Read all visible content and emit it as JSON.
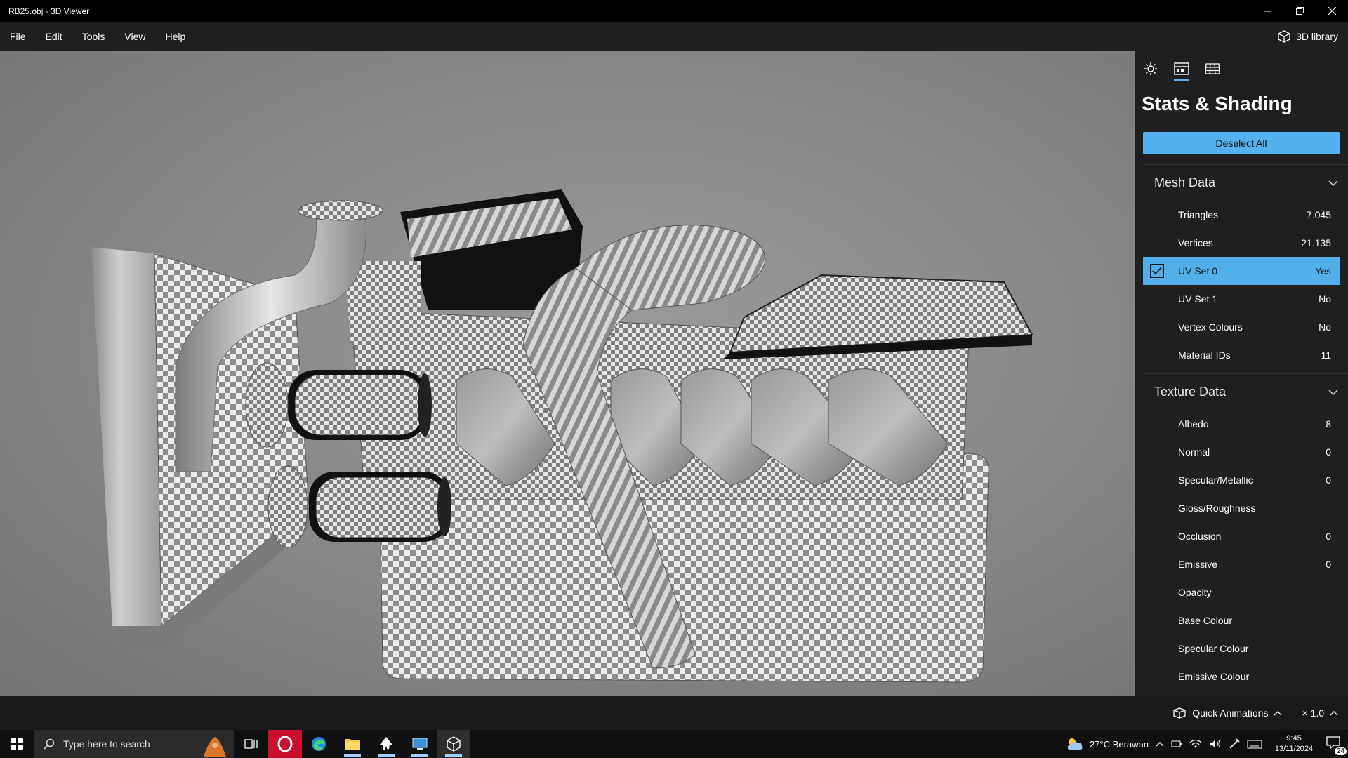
{
  "window": {
    "title": "RB25.obj - 3D Viewer"
  },
  "menu": {
    "items": [
      "File",
      "Edit",
      "Tools",
      "View",
      "Help"
    ],
    "library_label": "3D library"
  },
  "panel": {
    "title": "Stats & Shading",
    "deselect_label": "Deselect All",
    "mesh_section": {
      "label": "Mesh Data",
      "rows": [
        {
          "label": "Triangles",
          "value": "7.045"
        },
        {
          "label": "Vertices",
          "value": "21.135"
        },
        {
          "label": "UV Set 0",
          "value": "Yes"
        },
        {
          "label": "UV Set 1",
          "value": "No"
        },
        {
          "label": "Vertex Colours",
          "value": "No"
        },
        {
          "label": "Material IDs",
          "value": "11"
        }
      ]
    },
    "texture_section": {
      "label": "Texture Data",
      "rows": [
        {
          "label": "Albedo",
          "value": "8"
        },
        {
          "label": "Normal",
          "value": "0"
        },
        {
          "label": "Specular/Metallic",
          "value": "0"
        },
        {
          "label": "Gloss/Roughness",
          "value": ""
        },
        {
          "label": "Occlusion",
          "value": "0"
        },
        {
          "label": "Emissive",
          "value": "0"
        },
        {
          "label": "Opacity",
          "value": ""
        },
        {
          "label": "Base Colour",
          "value": ""
        },
        {
          "label": "Specular Colour",
          "value": ""
        },
        {
          "label": "Emissive Colour",
          "value": ""
        }
      ]
    }
  },
  "statusbar": {
    "quick_animations": "Quick Animations",
    "speed": "× 1.0"
  },
  "taskbar": {
    "search_placeholder": "Type here to search",
    "weather": "27°C  Berawan",
    "time": "9:45",
    "date": "13/11/2024",
    "notifications": "24"
  },
  "colors": {
    "accent": "#54b1ee",
    "selected_row": "#52aee9",
    "panel_bg": "#1f1f1f"
  }
}
